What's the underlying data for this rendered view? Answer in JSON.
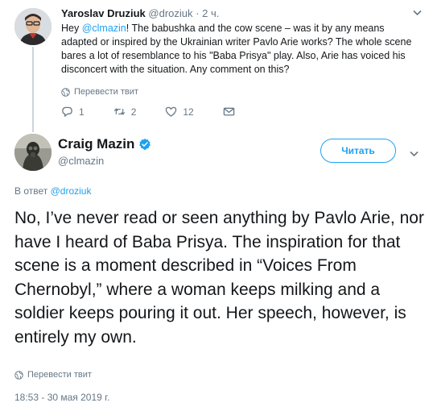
{
  "parent_tweet": {
    "author_name": "Yaroslav Druziuk",
    "handle": "@droziuk",
    "separator": "·",
    "time": "2 ч.",
    "text_before_mention": "Hey ",
    "mention": "@clmazin",
    "text_after_mention": "! The babushka and the cow scene – was it by any means adapted or inspired by the Ukrainian writer Pavlo Arie works? The whole scene bares a lot of resemblance to his \"Baba Prisya\" play. Also, Arie has voiced his disconcert with the situation. Any comment on this?",
    "translate_label": "Перевести твит",
    "reply_count": "1",
    "retweet_count": "2",
    "like_count": "12"
  },
  "main_tweet": {
    "author_name": "Craig Mazin",
    "handle": "@clmazin",
    "follow_label": "Читать",
    "reply_to_prefix": "В ответ ",
    "reply_to_handle": "@droziuk",
    "text": "No, I’ve never read or seen anything by Pavlo Arie, nor have I heard of Baba Prisya. The inspiration for that scene is a moment described in “Voices From Chernobyl,” where a woman keeps milking and a soldier keeps pouring it out. Her speech, however, is entirely my own.",
    "translate_label": "Перевести твит",
    "timestamp": "18:53 - 30 мая 2019 г."
  },
  "colors": {
    "accent": "#1da1f2",
    "secondary_text": "#657786",
    "primary_text": "#14171a",
    "thread_line": "#ccd6dd"
  },
  "icons": [
    "reply-icon",
    "retweet-icon",
    "like-icon",
    "mail-icon",
    "globe-icon",
    "verified-icon",
    "chevron-down-icon"
  ]
}
